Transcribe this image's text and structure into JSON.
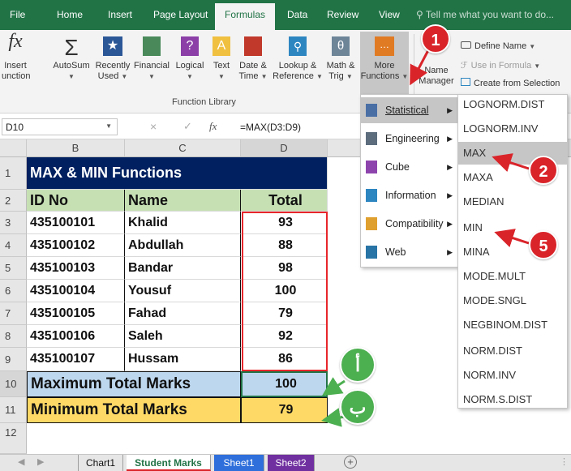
{
  "menubar": {
    "items": [
      "File",
      "Home",
      "Insert",
      "Page Layout",
      "Formulas",
      "Data",
      "Review",
      "View"
    ],
    "active": "Formulas",
    "tell_me": "Tell me what you want to do..."
  },
  "ribbon": {
    "insert_function": [
      "Insert",
      "unction"
    ],
    "autosum": "AutoSum",
    "recently_used": [
      "Recently",
      "Used"
    ],
    "financial": "Financial",
    "logical": "Logical",
    "text": "Text",
    "date_time": [
      "Date &",
      "Time"
    ],
    "lookup": [
      "Lookup &",
      "Reference"
    ],
    "math": [
      "Math &",
      "Trig"
    ],
    "more_functions": [
      "More",
      "Functions"
    ],
    "name_manager": [
      "Name",
      "Manager"
    ],
    "define_name": "Define Name",
    "use_in_formula": "Use in Formula",
    "create_from_selection": "Create from Selection",
    "group_label": "Function Library"
  },
  "formula_bar": {
    "name_box": "D10",
    "fx": "fx",
    "formula": "=MAX(D3:D9)"
  },
  "columns": [
    "B",
    "C",
    "D"
  ],
  "rows": [
    "1",
    "2",
    "3",
    "4",
    "5",
    "6",
    "7",
    "8",
    "9",
    "10",
    "11",
    "12"
  ],
  "sheet": {
    "title": "MAX & MIN Functions",
    "headers": [
      "ID No",
      "Name",
      "Total"
    ],
    "records": [
      [
        "435100101",
        "Khalid",
        "93"
      ],
      [
        "435100102",
        "Abdullah",
        "88"
      ],
      [
        "435100103",
        "Bandar",
        "98"
      ],
      [
        "435100104",
        "Yousuf",
        "100"
      ],
      [
        "435100105",
        "Fahad",
        "79"
      ],
      [
        "435100106",
        "Saleh",
        "92"
      ],
      [
        "435100107",
        "Hussam",
        "86"
      ]
    ],
    "max_label": "Maximum Total Marks",
    "max_value": "100",
    "min_label": "Minimum  Total Marks",
    "min_value": "79"
  },
  "more_functions_menu": [
    "Statistical",
    "Engineering",
    "Cube",
    "Information",
    "Compatibility",
    "Web"
  ],
  "statistical_menu": [
    "LOGNORM.DIST",
    "LOGNORM.INV",
    "MAX",
    "MAXA",
    "MEDIAN",
    "MIN",
    "MINA",
    "MODE.MULT",
    "MODE.SNGL",
    "NEGBINOM.DIST",
    "NORM.DIST",
    "NORM.INV",
    "NORM.S.DIST"
  ],
  "badges": {
    "one": "1",
    "two": "2",
    "five": "5",
    "alef": "أ",
    "ba": "ب"
  },
  "tabs": [
    "Chart1",
    "Student Marks",
    "Sheet1",
    "Sheet2"
  ],
  "colors": {
    "excel_green": "#217346",
    "title_navy": "#002060",
    "header_green": "#c6e0b4",
    "max_blue": "#bdd7ee",
    "min_yellow": "#ffd966",
    "annotation_red": "#d9242a",
    "annotation_green": "#4caf50"
  }
}
